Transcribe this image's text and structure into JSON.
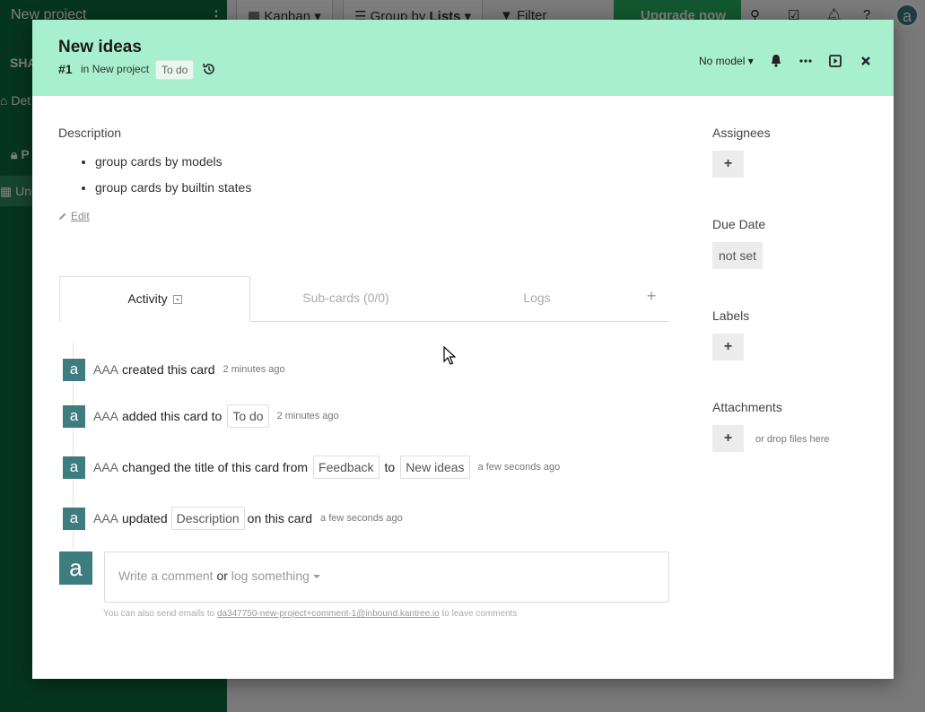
{
  "background": {
    "project_name": "New project",
    "sidebar_kebab": "⋮",
    "sidebar_heading": "SHA",
    "sidebar_item_1": "Det",
    "sidebar_item_2": "P",
    "sidebar_item_3": "Uns",
    "toolbar": {
      "kanban": "Kanban",
      "group_by_prefix": "Group by",
      "group_by_value": "Lists",
      "filter": "Filter",
      "upgrade": "Upgrade now",
      "avatar_letter": "a"
    }
  },
  "card": {
    "title": "New ideas",
    "number": "#1",
    "in_prefix": "in",
    "project": "New project",
    "state": "To do",
    "model": "No model",
    "description_label": "Description",
    "description_items": [
      "group cards by models",
      "group cards by builtin states"
    ],
    "edit_label": "Edit"
  },
  "tabs": {
    "activity": "Activity",
    "subcards": "Sub-cards (0/0)",
    "logs": "Logs",
    "add": "+"
  },
  "activity": [
    {
      "avatar": "a",
      "user": "AAA",
      "text": "created this card",
      "time": "2 minutes ago"
    },
    {
      "avatar": "a",
      "user": "AAA",
      "text": "added this card to",
      "pill": "To do",
      "time": "2 minutes ago"
    },
    {
      "avatar": "a",
      "user": "AAA",
      "text": "changed the title of this card from",
      "from": "Feedback",
      "to_word": "to",
      "to": "New ideas",
      "time": "a few seconds ago"
    },
    {
      "avatar": "a",
      "user": "AAA",
      "text": "updated",
      "pill": "Description",
      "text2": "on this card",
      "time": "a few seconds ago"
    }
  ],
  "comment": {
    "avatar": "a",
    "placeholder_part1": "Write a comment",
    "or": "or",
    "placeholder_part2": "log something",
    "hint_prefix": "You can also send emails to",
    "hint_email": "da347750-new-project+comment-1@inbound.kantree.io",
    "hint_suffix": "to leave comments"
  },
  "sidebar": {
    "assignees_label": "Assignees",
    "due_date_label": "Due Date",
    "due_date_value": "not set",
    "labels_label": "Labels",
    "attachments_label": "Attachments",
    "drop_hint": "or drop files here",
    "plus": "+"
  },
  "colors": {
    "header_bg": "#a8f0cd",
    "sidebar_green": "#0d6b3a",
    "avatar_teal": "#3d7d80",
    "upgrade_green": "#27ae60"
  }
}
